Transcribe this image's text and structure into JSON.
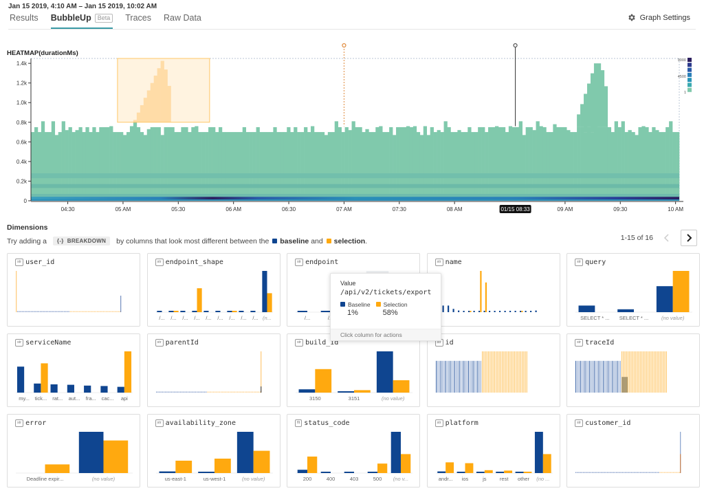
{
  "header": {
    "time_range": "Jan 15 2019, 4:10 AM – Jan 15 2019, 10:02 AM",
    "tabs": [
      {
        "label": "Results",
        "active": false
      },
      {
        "label": "BubbleUp",
        "active": true,
        "badge": "Beta"
      },
      {
        "label": "Traces",
        "active": false
      },
      {
        "label": "Raw Data",
        "active": false
      }
    ],
    "graph_settings_label": "Graph Settings"
  },
  "heatmap": {
    "title": "HEATMAP(durationMs)",
    "y_ticks": [
      "0",
      "0.2k",
      "0.4k",
      "0.6k",
      "0.8k",
      "1.0k",
      "1.2k",
      "1.4k"
    ],
    "x_ticks": [
      "04:30",
      "05 AM",
      "05:30",
      "06 AM",
      "06:30",
      "07 AM",
      "07:30",
      "08 AM",
      "09 AM",
      "09:30",
      "10 AM"
    ],
    "cursor_label": "01/15 08:33",
    "legend": {
      "max": "9000",
      "mid": "4500",
      "min": "1"
    },
    "colors": {
      "low": "#80c9ac",
      "mid": "#2a8fb8",
      "high": "#2c1f5e",
      "selection": "#ffb347"
    },
    "selection": {
      "time_start": "04:57",
      "time_end": "05:47",
      "duration_min": 800,
      "duration_max": 1450
    },
    "markers": [
      {
        "time": "07:00",
        "style": "dashed-orange"
      },
      {
        "time": "08:33",
        "style": "solid-black"
      }
    ]
  },
  "dimensions": {
    "title": "Dimensions",
    "hint_prefix": "Try adding a ",
    "breakdown_chip": "{-}  BREAKDOWN",
    "hint_middle": " by columns that look most different between the ",
    "baseline_label": "baseline",
    "and": " and ",
    "selection_label": "selection",
    "period": ".",
    "pagination": "1-15 of 16",
    "colors": {
      "baseline": "#0f4590",
      "selection": "#ffa90f"
    }
  },
  "cards": [
    {
      "type": "str",
      "name": "user_id",
      "kind": "dense",
      "dense": {
        "baselineFrac": 0.52,
        "baseHigh": 0.4,
        "selHigh": 1.0,
        "spikeAtStart": "selection",
        "spikeAtEnd": "baseline"
      }
    },
    {
      "type": "str",
      "name": "endpoint_shape",
      "kind": "bars",
      "labels": [
        "/...",
        "/...",
        "/...",
        "/...",
        "/...",
        "/...",
        "/...",
        "/...",
        "/...",
        "(n..."
      ],
      "baseline": [
        2,
        2,
        2,
        2,
        2,
        2,
        2,
        2,
        2,
        100
      ],
      "selection": [
        0,
        2,
        0,
        58,
        0,
        0,
        2,
        0,
        0,
        46
      ]
    },
    {
      "type": "str",
      "name": "endpoint",
      "kind": "bars",
      "labels": [
        "/...",
        "/...",
        "/...",
        "/...",
        "/..."
      ],
      "baseline": [
        2,
        2,
        2,
        2,
        2
      ],
      "selection": [
        0,
        2,
        0,
        58,
        0
      ],
      "hovered": 3
    },
    {
      "type": "str",
      "name": "name",
      "kind": "bars_thin",
      "baseline": [
        18,
        16,
        16,
        8,
        4,
        3,
        2,
        2,
        2,
        2,
        2,
        2,
        2,
        2,
        2,
        2,
        2,
        2,
        2,
        4
      ],
      "selection": [
        0,
        0,
        0,
        0,
        0,
        0,
        2,
        0,
        100,
        72,
        0,
        0,
        0,
        0,
        0,
        0,
        2,
        0,
        0,
        0
      ]
    },
    {
      "type": "str",
      "name": "query",
      "kind": "bars",
      "labels": [
        "SELECT * ...",
        "SELECT * ...",
        "(no value)"
      ],
      "baseline": [
        16,
        7,
        63
      ],
      "selection": [
        0,
        0,
        100
      ]
    },
    {
      "type": "str",
      "name": "serviceName",
      "kind": "bars",
      "labels": [
        "my...",
        "tick...",
        "rat...",
        "aut...",
        "fra...",
        "cac...",
        "api"
      ],
      "baseline": [
        63,
        22,
        20,
        19,
        17,
        16,
        14
      ],
      "selection": [
        0,
        71,
        0,
        0,
        0,
        0,
        100
      ]
    },
    {
      "type": "str",
      "name": "parentId",
      "kind": "dense",
      "dense": {
        "baselineFrac": 0.48,
        "baseHigh": 0.15,
        "selHigh": 1.0,
        "spikeAtEnd": "selection"
      }
    },
    {
      "type": "str",
      "name": "build_id",
      "kind": "bars",
      "labels": [
        "3150",
        "3151",
        "(no value)"
      ],
      "baseline": [
        8,
        3,
        100
      ],
      "selection": [
        57,
        6,
        30
      ]
    },
    {
      "type": "str",
      "name": "id",
      "kind": "stripes",
      "stripes": {
        "baselineFrac": 0.5,
        "baseHeight": 0.77,
        "selHeight": 1.0
      }
    },
    {
      "type": "str",
      "name": "traceId",
      "kind": "stripes",
      "stripes": {
        "baselineFrac": 0.5,
        "baseHeight": 0.77,
        "selHeight": 1.0,
        "overlap": 0.38
      }
    },
    {
      "type": "str",
      "name": "error",
      "kind": "bars",
      "labels": [
        "Deadline expir...",
        "(no value)"
      ],
      "baseline": [
        0,
        100
      ],
      "selection": [
        21,
        79
      ],
      "italic_last": true
    },
    {
      "type": "str",
      "name": "availability_zone",
      "kind": "bars",
      "labels": [
        "us-east-1",
        "us-west-1",
        "(no value)"
      ],
      "baseline": [
        4,
        3,
        100
      ],
      "selection": [
        30,
        35,
        54
      ]
    },
    {
      "type": "flt",
      "name": "status_code",
      "kind": "bars",
      "labels": [
        "200",
        "400",
        "403",
        "500",
        "(no v..."
      ],
      "baseline": [
        8,
        3,
        3,
        3,
        100
      ],
      "selection": [
        40,
        0,
        0,
        23,
        46
      ]
    },
    {
      "type": "str",
      "name": "platform",
      "kind": "bars",
      "labels": [
        "andr...",
        "ios",
        "js",
        "rest",
        "other",
        "(no ..."
      ],
      "baseline": [
        4,
        3,
        3,
        3,
        3,
        100
      ],
      "selection": [
        26,
        24,
        7,
        6,
        3,
        46
      ]
    },
    {
      "type": "str",
      "name": "customer_id",
      "kind": "dense",
      "dense": {
        "baselineFrac": 0.8,
        "baseHigh": 1.0,
        "selHigh": 0.46,
        "spikeAtEnd": "both"
      }
    }
  ],
  "tooltip": {
    "label": "Value",
    "value": "/api/v2/tickets/export",
    "baseline_label": "Baseline",
    "selection_label": "Selection",
    "baseline_pct": "1%",
    "selection_pct": "58%",
    "footer": "Click column for actions"
  }
}
